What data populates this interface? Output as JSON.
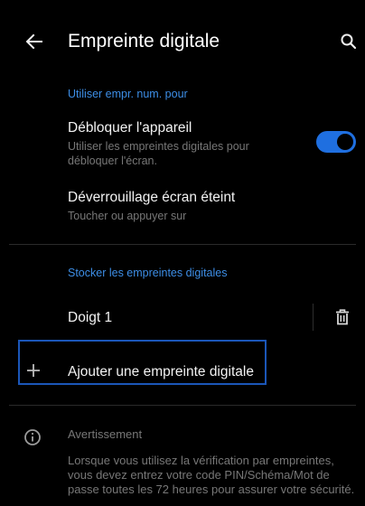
{
  "appbar": {
    "title": "Empreinte digitale",
    "back_icon": "arrow-left-icon",
    "search_icon": "search-icon"
  },
  "section_use": {
    "header": "Utiliser empr. num. pour",
    "unlock": {
      "title": "Débloquer l'appareil",
      "subtitle": "Utiliser les empreintes digitales pour débloquer l'écran.",
      "toggle_on": true
    },
    "screen_off": {
      "title": "Déverrouillage écran éteint",
      "subtitle": "Toucher ou appuyer sur"
    }
  },
  "section_store": {
    "header": "Stocker les empreintes digitales",
    "fingerprints": [
      {
        "label": "Doigt 1",
        "delete_icon": "trash-icon"
      }
    ],
    "add_label": "Ajouter une empreinte digitale",
    "add_icon": "plus-icon"
  },
  "warning": {
    "icon": "info-icon",
    "title": "Avertissement",
    "body": "Lorsque vous utilisez la vérification par empreintes, vous devez entrez votre code PIN/Schéma/Mot de passe toutes les 72 heures pour assurer votre sécurité."
  },
  "colors": {
    "accent": "#3d8ee6",
    "toggle": "#1f6fe0",
    "background": "#000000",
    "focus_border": "#1b56b8"
  }
}
